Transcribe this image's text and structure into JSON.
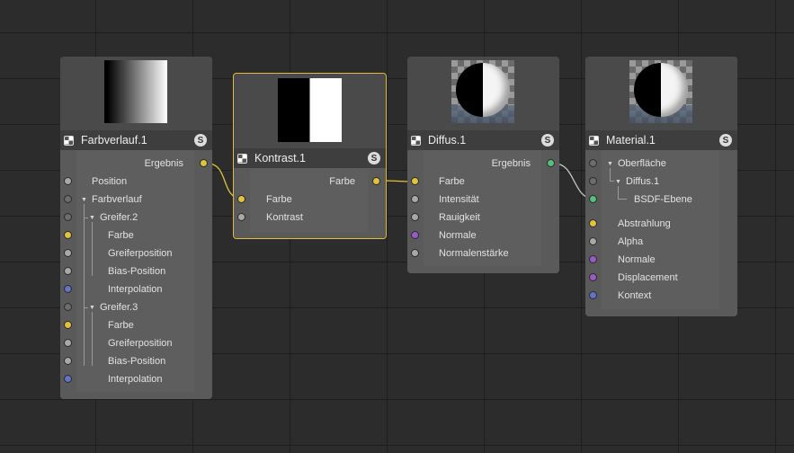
{
  "colors": {
    "port_yellow": "#e2c23a",
    "port_green": "#54c07a",
    "port_purple": "#9a5bc8",
    "port_blue": "#6273c8",
    "port_grey": "#a8a8a8",
    "selected_border": "#e5b93a"
  },
  "nodes": {
    "farbverlauf": {
      "title": "Farbverlauf.1",
      "badge": "S",
      "output": "Ergebnis",
      "rows": [
        "Position",
        "Farbverlauf",
        "Greifer.2",
        "Farbe",
        "Greiferposition",
        "Bias-Position",
        "Interpolation",
        "Greifer.3",
        "Farbe",
        "Greiferposition",
        "Bias-Position",
        "Interpolation"
      ]
    },
    "kontrast": {
      "title": "Kontrast.1",
      "badge": "S",
      "output": "Farbe",
      "rows": [
        "Farbe",
        "Kontrast"
      ]
    },
    "diffus": {
      "title": "Diffus.1",
      "badge": "S",
      "output": "Ergebnis",
      "rows": [
        "Farbe",
        "Intensität",
        "Rauigkeit",
        "Normale",
        "Normalenstärke"
      ]
    },
    "material": {
      "title": "Material.1",
      "badge": "S",
      "rows": [
        "Oberfläche",
        "Diffus.1",
        "BSDF-Ebene",
        "Abstrahlung",
        "Alpha",
        "Normale",
        "Displacement",
        "Kontext"
      ]
    }
  }
}
